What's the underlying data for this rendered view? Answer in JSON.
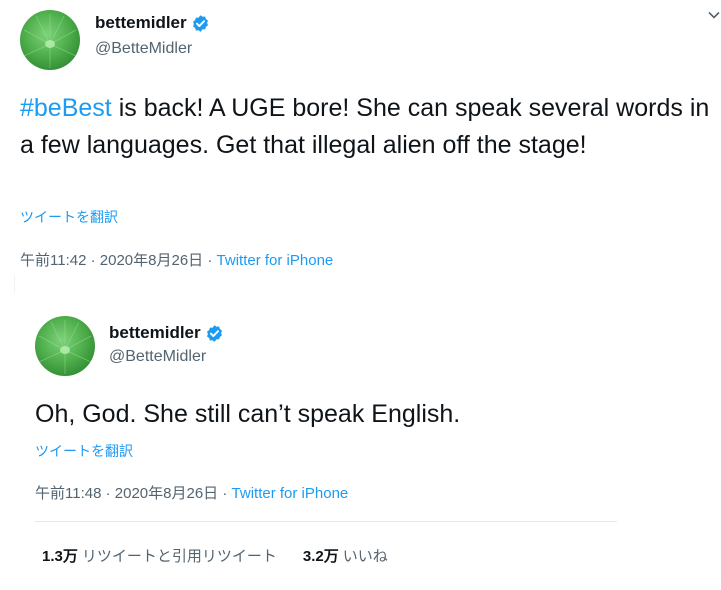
{
  "tweets": [
    {
      "display_name": "bettemidler",
      "handle": "@BetteMidler",
      "hashtag": "#beBest",
      "text": " is back!  A UGE bore!  She can speak several words in a few languages.  Get that illegal alien off the stage!",
      "translate_label": "ツイートを翻訳",
      "time": "午前11:42",
      "date": "2020年8月26日",
      "source": "Twitter for iPhone"
    },
    {
      "display_name": "bettemidler",
      "handle": "@BetteMidler",
      "text": "Oh, God.  She still can’t speak English.",
      "translate_label": "ツイートを翻訳",
      "time": "午前11:48",
      "date": "2020年8月26日",
      "source": "Twitter for iPhone",
      "retweets_count": "1.3万",
      "retweets_label": "リツイートと引用リツイート",
      "likes_count": "3.2万",
      "likes_label": "いいね"
    }
  ],
  "separator": " · ",
  "colors": {
    "link": "#1d9bf0",
    "secondary": "#536471",
    "verified": "#1d9bf0"
  },
  "icons": {
    "verified": "verified-badge-icon",
    "more": "chevron-down-icon"
  }
}
